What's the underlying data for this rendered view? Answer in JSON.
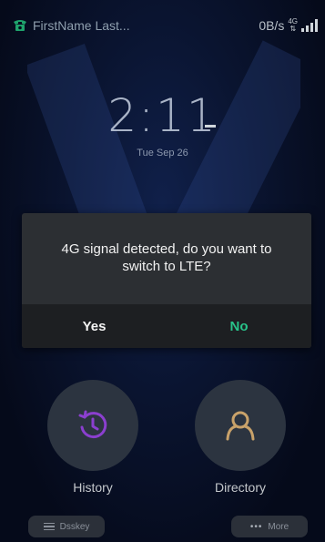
{
  "status_bar": {
    "account_name": "FirstName Last...",
    "data_rate": "0B/s",
    "network_tag": "4G",
    "network_arrows": "⇅"
  },
  "lock_screen": {
    "time": "2:11",
    "date": "Tue Sep 26"
  },
  "dialog": {
    "message": "4G signal detected, do you want to switch to LTE?",
    "yes_label": "Yes",
    "no_label": "No"
  },
  "shortcuts": [
    {
      "label": "History",
      "icon": "history-icon",
      "accent": "#8b3fcf"
    },
    {
      "label": "Directory",
      "icon": "contact-icon",
      "accent": "#c9a26a"
    }
  ],
  "bottom_bar": {
    "dsskey_label": "Dsskey",
    "more_label": "More"
  },
  "colors": {
    "dialog_bg": "#2c2f33",
    "dialog_actions_bg": "#1d1f22",
    "no_accent": "#28c38a"
  }
}
